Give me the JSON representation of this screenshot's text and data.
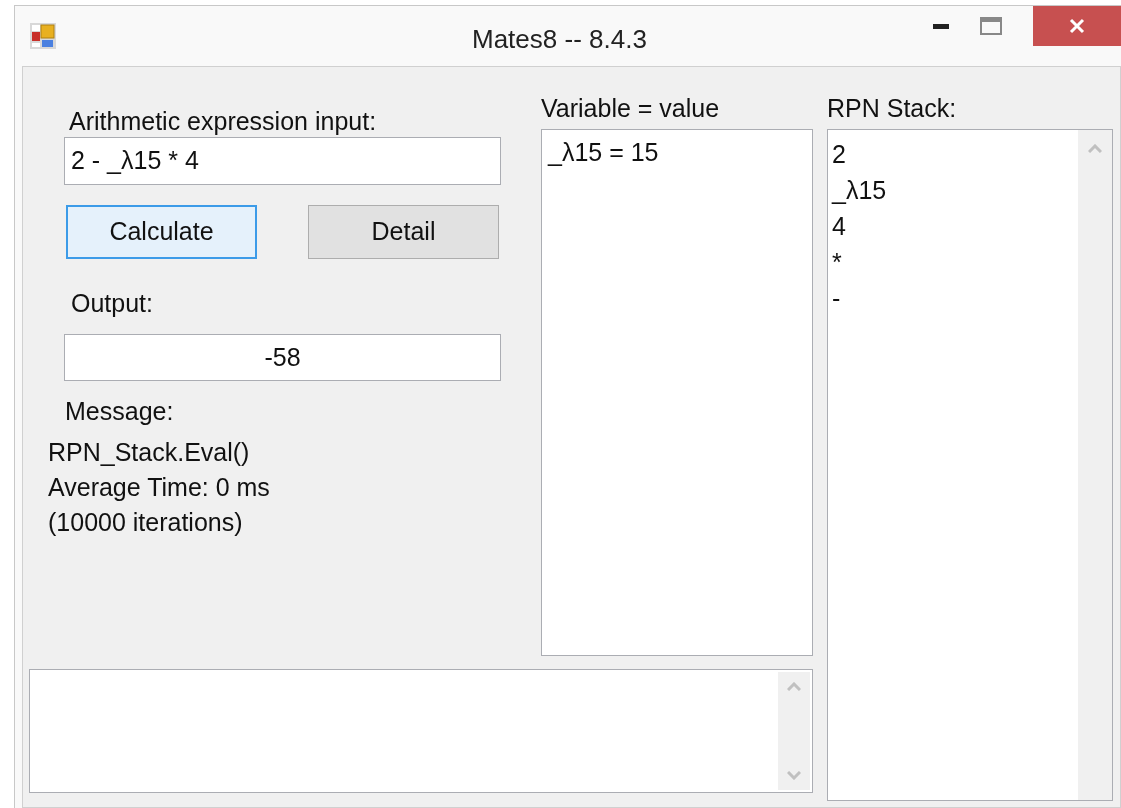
{
  "window": {
    "title": "Mates8 -- 8.4.3"
  },
  "expression": {
    "label": "Arithmetic expression input:",
    "value": "2 - _λ15 * 4"
  },
  "buttons": [
    {
      "label": "Calculate",
      "selected": true
    },
    {
      "label": "Detail",
      "selected": false
    }
  ],
  "output": {
    "label": "Output:",
    "value": "-58"
  },
  "message": {
    "label": "Message:",
    "lines": [
      "RPN_Stack.Eval()",
      "Average Time: 0 ms",
      "(10000 iterations)"
    ]
  },
  "variables": {
    "label": "Variable = value",
    "items": [
      "_λ15 = 15"
    ]
  },
  "rpn_stack": {
    "label": "RPN Stack:",
    "items": [
      "2",
      "_λ15",
      "4",
      "*",
      "-"
    ]
  }
}
